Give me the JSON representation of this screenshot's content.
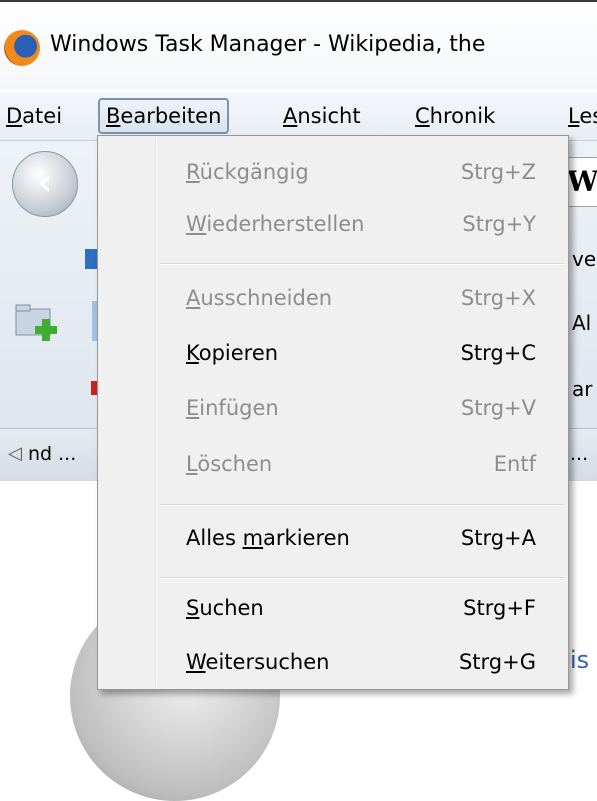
{
  "window": {
    "title": "Windows Task Manager - Wikipedia, the"
  },
  "menubar": {
    "items": [
      {
        "mnemonic": "D",
        "rest": "atei"
      },
      {
        "mnemonic": "B",
        "rest": "earbeiten"
      },
      {
        "mnemonic": "A",
        "rest": "nsicht"
      },
      {
        "mnemonic": "C",
        "rest": "hronik"
      },
      {
        "mnemonic": "L",
        "rest": "es"
      }
    ]
  },
  "toolbar": {
    "address_char": "W",
    "text_1": "ve",
    "text_2": "Al",
    "text_3": "ar"
  },
  "tabbar": {
    "tab_1": "nd ...",
    "tab_2": "..."
  },
  "content": {
    "snippet": "is"
  },
  "edit_menu": {
    "items": [
      {
        "pre": "",
        "mnemonic": "R",
        "post": "ückgängig",
        "shortcut": "Strg+Z",
        "enabled": false
      },
      {
        "pre": "",
        "mnemonic": "W",
        "post": "iederherstellen",
        "shortcut": "Strg+Y",
        "enabled": false
      },
      {
        "pre": "",
        "mnemonic": "A",
        "post": "usschneiden",
        "shortcut": "Strg+X",
        "enabled": false
      },
      {
        "pre": "",
        "mnemonic": "K",
        "post": "opieren",
        "shortcut": "Strg+C",
        "enabled": true
      },
      {
        "pre": "",
        "mnemonic": "E",
        "post": "infügen",
        "shortcut": "Strg+V",
        "enabled": false
      },
      {
        "pre": "",
        "mnemonic": "L",
        "post": "öschen",
        "shortcut": "Entf",
        "enabled": false
      },
      {
        "pre": "Alles ",
        "mnemonic": "m",
        "post": "arkieren",
        "shortcut": "Strg+A",
        "enabled": true
      },
      {
        "pre": "",
        "mnemonic": "S",
        "post": "uchen",
        "shortcut": "Strg+F",
        "enabled": true
      },
      {
        "pre": "",
        "mnemonic": "W",
        "post": "eitersuchen",
        "shortcut": "Strg+G",
        "enabled": true
      }
    ]
  }
}
